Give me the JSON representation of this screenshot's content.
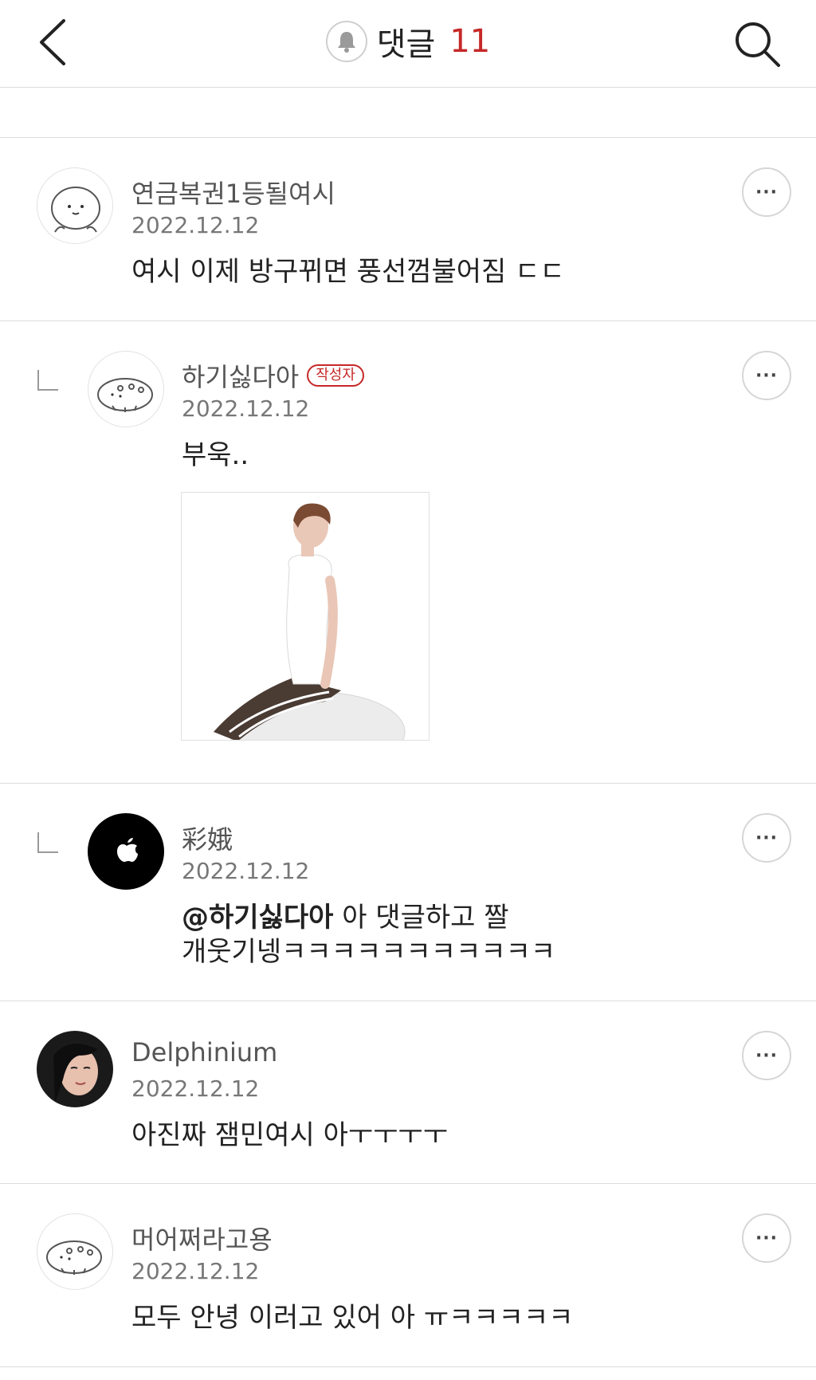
{
  "header": {
    "title": "댓글",
    "count": "11"
  },
  "comments": [
    {
      "author": "연금복권1등될여시",
      "date": "2022.12.12",
      "text": "여시 이제 방구뀌면 풍선껌불어짐 ㄷㄷ",
      "more": "···"
    },
    {
      "author": "하기싫다아",
      "badge": "작성자",
      "date": "2022.12.12",
      "text": "부욱..",
      "more": "···"
    },
    {
      "author": "彩娥",
      "date": "2022.12.12",
      "mention": "@하기싫다아",
      "text_line1": " 아 댓글하고 짤",
      "text_line2": "개웃기넹ㅋㅋㅋㅋㅋㅋㅋㅋㅋㅋㅋ",
      "more": "···"
    },
    {
      "author": "Delphinium",
      "date": "2022.12.12",
      "text": "아진짜 잼민여시 아ㅜㅜㅜㅜ",
      "more": "···"
    },
    {
      "author": "머어쩌라고용",
      "date": "2022.12.12",
      "text": "모두 안녕 이러고 있어 아 ㅠㅋㅋㅋㅋㅋ",
      "more": "···"
    }
  ],
  "icons": {
    "back": "chevron-left-icon",
    "search": "search-icon",
    "bell": "bell-icon",
    "more": "more-icon",
    "reply": "reply-indent-icon"
  },
  "colors": {
    "accent": "#c62828",
    "divider": "#dcdcdc"
  }
}
